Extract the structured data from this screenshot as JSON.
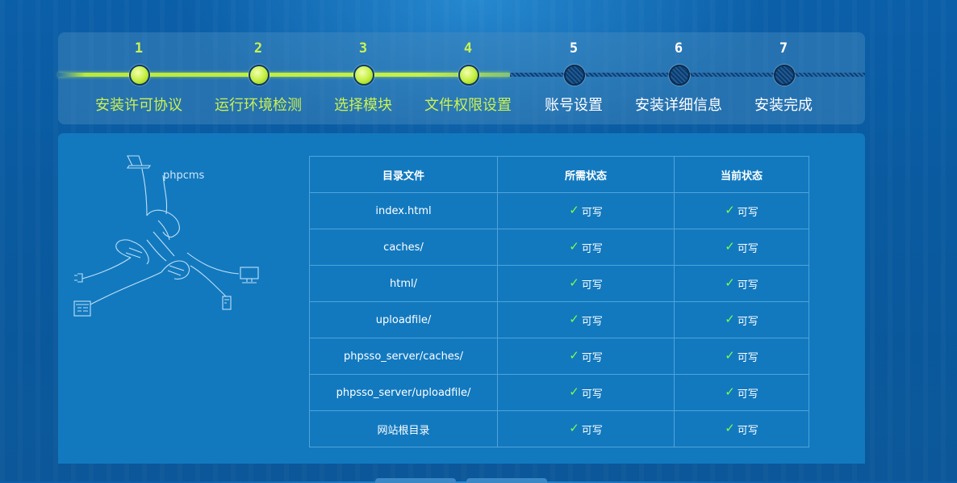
{
  "steps": [
    {
      "num": "1",
      "label": "安装许可协议",
      "status": "done"
    },
    {
      "num": "2",
      "label": "运行环境检测",
      "status": "done"
    },
    {
      "num": "3",
      "label": "选择模块",
      "status": "done"
    },
    {
      "num": "4",
      "label": "文件权限设置",
      "status": "done"
    },
    {
      "num": "5",
      "label": "账号设置",
      "status": "todo"
    },
    {
      "num": "6",
      "label": "安装详细信息",
      "status": "todo"
    },
    {
      "num": "7",
      "label": "安装完成",
      "status": "todo"
    }
  ],
  "illustration": {
    "brand": "phpcms"
  },
  "table": {
    "headers": [
      "目录文件",
      "所需状态",
      "当前状态"
    ],
    "rows": [
      {
        "dir": "index.html",
        "required": "可写",
        "current": "可写"
      },
      {
        "dir": "caches/",
        "required": "可写",
        "current": "可写"
      },
      {
        "dir": "html/",
        "required": "可写",
        "current": "可写"
      },
      {
        "dir": "uploadfile/",
        "required": "可写",
        "current": "可写"
      },
      {
        "dir": "phpsso_server/caches/",
        "required": "可写",
        "current": "可写"
      },
      {
        "dir": "phpsso_server/uploadfile/",
        "required": "可写",
        "current": "可写"
      },
      {
        "dir": "网站根目录",
        "required": "可写",
        "current": "可写"
      }
    ]
  },
  "colors": {
    "accent_done": "#c9f252",
    "check": "#7dff4a",
    "panel": "#1279bf",
    "background": "#0b5fa8"
  }
}
